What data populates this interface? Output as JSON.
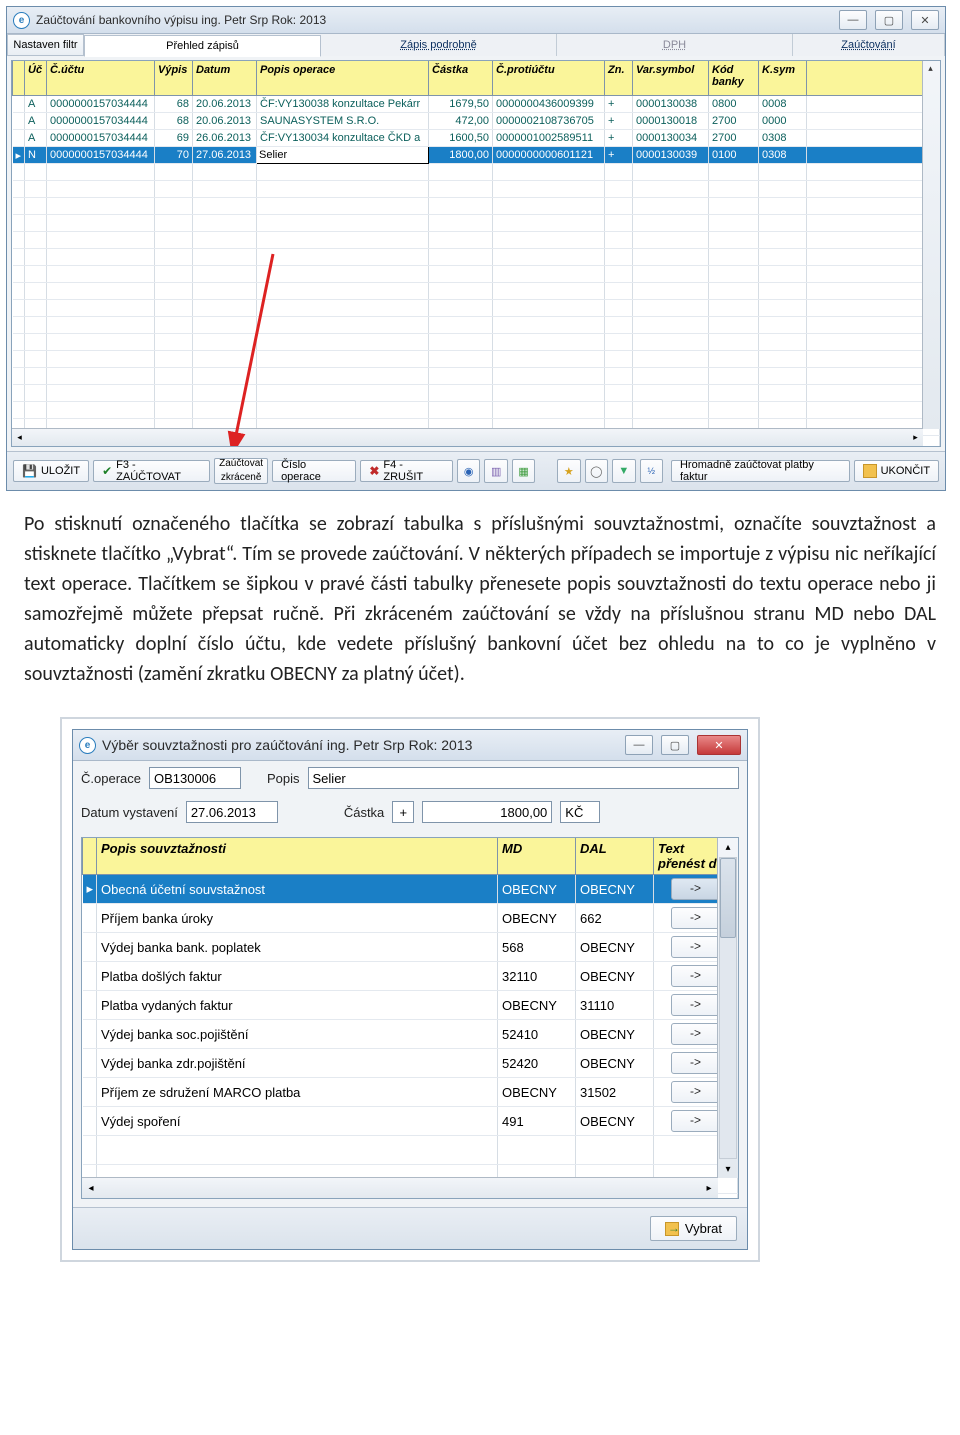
{
  "window1": {
    "title": "Zaúčtování bankovního výpisu  ing. Petr Srp  Rok: 2013",
    "nav": {
      "filter_label": "Nastaven filtr",
      "tabs": [
        "Přehled zápisů",
        "Zápis podrobně",
        "DPH",
        "Zaúčtování"
      ]
    },
    "grid": {
      "headers": [
        "Úč",
        "Č.účtu",
        "Výpis",
        "Datum",
        "Popis operace",
        "Částka",
        "Č.protiúčtu",
        "Zn.",
        "Var.symbol",
        "Kód banky",
        "K.sym"
      ],
      "rows": [
        {
          "sel": false,
          "cells": [
            "A",
            "0000000157034444",
            "68",
            "20.06.2013",
            "ČF:VY130038 konzultace Pekárr",
            "1679,50",
            "0000000436009399",
            "+",
            "0000130038",
            "0800",
            "0008"
          ]
        },
        {
          "sel": false,
          "cells": [
            "A",
            "0000000157034444",
            "68",
            "20.06.2013",
            "SAUNASYSTEM S.R.O.",
            "472,00",
            "0000002108736705",
            "+",
            "0000130018",
            "2700",
            "0000"
          ]
        },
        {
          "sel": false,
          "cells": [
            "A",
            "0000000157034444",
            "69",
            "26.06.2013",
            "ČF:VY130034 konzultace ČKD a",
            "1600,50",
            "0000001002589511",
            "+",
            "0000130034",
            "2700",
            "0308"
          ]
        },
        {
          "sel": true,
          "cells": [
            "N",
            "0000000157034444",
            "70",
            "27.06.2013",
            "Selier",
            "1800,00",
            "0000000000601121",
            "+",
            "0000130039",
            "0100",
            "0308"
          ]
        }
      ]
    },
    "toolbar": {
      "save": "ULOŽIT",
      "f3": "F3 - ZAÚČTOVAT",
      "zkracene1": "Zaúčtovat",
      "zkracene2": "zkráceně",
      "cislo": "Číslo operace",
      "f4": "F4 - ZRUŠIT",
      "hromadne": "Hromadně zaúčtovat platby faktur",
      "ukoncit": "UKONČIT"
    }
  },
  "doc_text": "Po stisknutí označeného tlačítka se zobrazí tabulka s příslušnými souvztažnostmi, označíte souvztažnost a stisknete tlačítko „Vybrat“. Tím se provede zaúčtování. V některých případech se importuje z výpisu nic neříkající text operace. Tlačítkem se šipkou v pravé části tabulky přenesete popis souvztažnosti do textu operace nebo ji samozřejmě můžete přepsat ručně. Při zkráceném zaúčtování se vždy na příslušnou stranu MD nebo DAL automaticky doplní číslo účtu, kde vedete příslušný bankovní účet bez ohledu na to co je vyplněno v souvztažnosti (zamění zkratku OBECNY za platný účet).",
  "window2": {
    "title": "Výběr souvztažnosti pro zaúčtování  ing. Petr Srp  Rok: 2013",
    "form": {
      "op_label": "Č.operace",
      "op_value": "OB130006",
      "popis_label": "Popis",
      "popis_value": "Selier",
      "datum_label": "Datum vystavení",
      "datum_value": "27.06.2013",
      "castka_label": "Částka",
      "sign": "+",
      "castka_value": "1800,00",
      "mena": "KČ"
    },
    "grid": {
      "headers": [
        "Popis souvztažnosti",
        "MD",
        "DAL",
        "Text přenést do"
      ],
      "rows": [
        {
          "sel": true,
          "popis": "Obecná účetní souvstažnost",
          "md": "OBECNY",
          "dal": "OBECNY"
        },
        {
          "sel": false,
          "popis": "Příjem banka úroky",
          "md": "OBECNY",
          "dal": "662"
        },
        {
          "sel": false,
          "popis": "Výdej  banka bank. poplatek",
          "md": "568",
          "dal": "OBECNY"
        },
        {
          "sel": false,
          "popis": "Platba došlých faktur",
          "md": "32110",
          "dal": "OBECNY"
        },
        {
          "sel": false,
          "popis": "Platba vydaných faktur",
          "md": "OBECNY",
          "dal": "31110"
        },
        {
          "sel": false,
          "popis": "Výdej banka soc.pojištění",
          "md": "52410",
          "dal": "OBECNY"
        },
        {
          "sel": false,
          "popis": "Výdej banka zdr.pojištění",
          "md": "52420",
          "dal": "OBECNY"
        },
        {
          "sel": false,
          "popis": "Příjem ze sdružení MARCO platba",
          "md": "OBECNY",
          "dal": "31502"
        },
        {
          "sel": false,
          "popis": "Výdej spoření",
          "md": "491",
          "dal": "OBECNY"
        }
      ],
      "arrow_label": "->"
    },
    "footer": {
      "vybrat": "Vybrat"
    }
  }
}
